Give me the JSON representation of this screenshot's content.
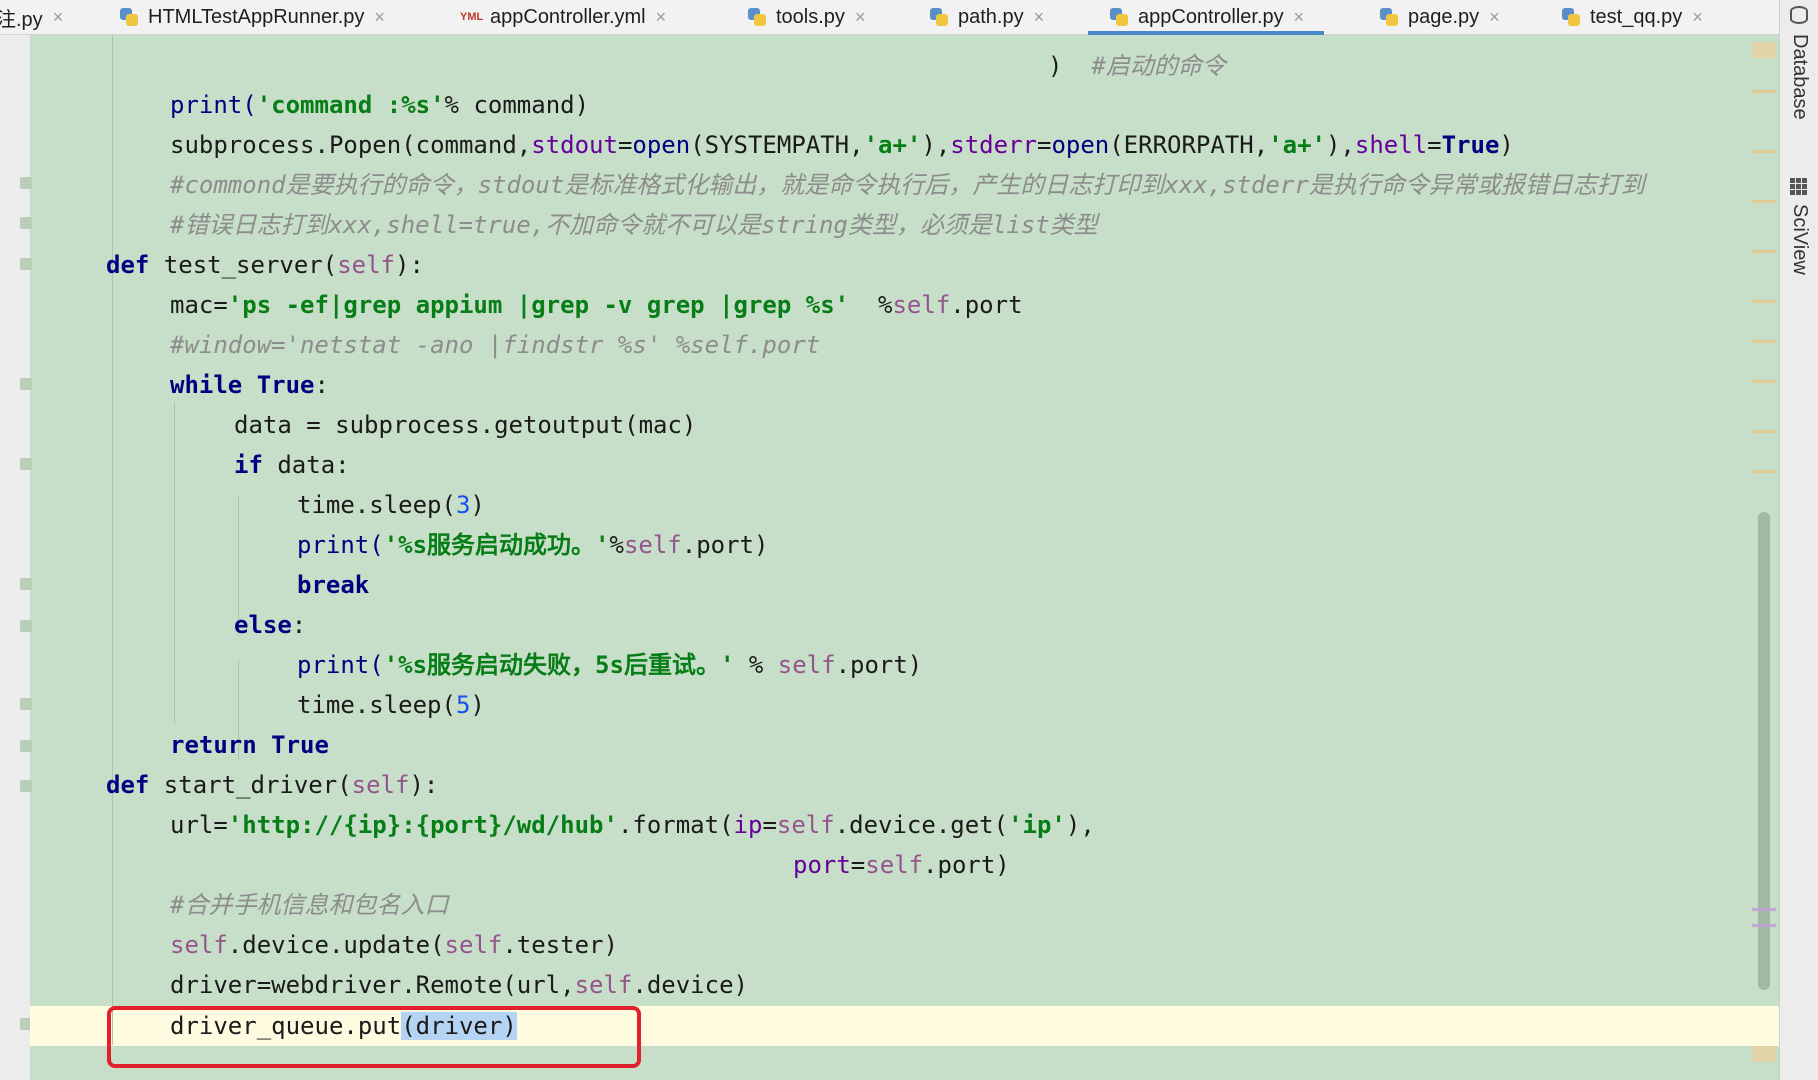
{
  "tabs": [
    {
      "label": "注.py",
      "icon": "python-file-icon",
      "active": false
    },
    {
      "label": "HTMLTestAppRunner.py",
      "icon": "python-file-icon",
      "active": false
    },
    {
      "label": "appController.yml",
      "icon": "yaml-file-icon",
      "active": false
    },
    {
      "label": "tools.py",
      "icon": "python-file-icon",
      "active": false
    },
    {
      "label": "path.py",
      "icon": "python-file-icon",
      "active": false
    },
    {
      "label": "appController.py",
      "icon": "python-file-icon",
      "active": true
    },
    {
      "label": "page.py",
      "icon": "python-file-icon",
      "active": false
    },
    {
      "label": "test_qq.py",
      "icon": "python-file-icon",
      "active": false
    }
  ],
  "tab_close_glyph": "×",
  "yml_icon_text": "YML",
  "right_panel": {
    "database_label": "Database",
    "sciview_label": "SciView"
  },
  "code": {
    "l0_close": ")",
    "l0_comment": "#启动的命令",
    "l1_print": "print(",
    "l1_str": "'command :%s'",
    "l1_rest": "% command)",
    "l2_a": "subprocess.Popen(command,",
    "l2_stdout": "stdout",
    "l2_eq1": "=",
    "l2_open1": "open",
    "l2_b": "(SYSTEMPATH,",
    "l2_str1": "'a+'",
    "l2_c": "),",
    "l2_stderr": "stderr",
    "l2_eq2": "=",
    "l2_open2": "open",
    "l2_d": "(ERRORPATH,",
    "l2_str2": "'a+'",
    "l2_e": "),",
    "l2_shell": "shell",
    "l2_eq3": "=",
    "l2_true": "True",
    "l2_f": ")",
    "l3_comment": "#commond是要执行的命令，stdout是标准格式化输出，就是命令执行后，产生的日志打印到xxx,stderr是执行命令异常或报错日志打到",
    "l4_comment": "#错误日志打到xxx,shell=true,不加命令就不可以是string类型，必须是list类型",
    "l5_def": "def",
    "l5_name": " test_server(",
    "l5_self": "self",
    "l5_end": "):",
    "l6_a": "mac=",
    "l6_str": "'ps -ef|grep appium |grep -v grep |grep %s'",
    "l6_b": "  %",
    "l6_self": "self",
    "l6_c": ".port",
    "l7_comment": "#window='netstat -ano |findstr %s' %self.port",
    "l8_while": "while",
    "l8_true": " True",
    "l8_end": ":",
    "l9": "data = subprocess.getoutput(mac)",
    "l10_if": "if",
    "l10_rest": " data:",
    "l11_a": "time.sleep(",
    "l11_num": "3",
    "l11_b": ")",
    "l12_print": "print(",
    "l12_str": "'%s服务启动成功。'",
    "l12_b": "%",
    "l12_self": "self",
    "l12_c": ".port)",
    "l13_break": "break",
    "l14_else": "else",
    "l14_end": ":",
    "l15_print": "print(",
    "l15_str": "'%s服务启动失败，5s后重试。'",
    "l15_b": " % ",
    "l15_self": "self",
    "l15_c": ".port)",
    "l16_a": "time.sleep(",
    "l16_num": "5",
    "l16_b": ")",
    "l17_return": "return",
    "l17_true": " True",
    "l18_def": "def",
    "l18_name": " start_driver(",
    "l18_self": "self",
    "l18_end": "):",
    "l19_a": "url=",
    "l19_str": "'http://{ip}:{port}/wd/hub'",
    "l19_b": ".format(",
    "l19_ip": "ip",
    "l19_c": "=",
    "l19_self": "self",
    "l19_d": ".device.get(",
    "l19_str2": "'ip'",
    "l19_e": "),",
    "l20_port": "port",
    "l20_a": "=",
    "l20_self": "self",
    "l20_b": ".port)",
    "l21_comment": "#合并手机信息和包名入口",
    "l22_self1": "self",
    "l22_a": ".device.update(",
    "l22_self2": "self",
    "l22_b": ".tester)",
    "l23_a": "driver=webdriver.Remote(url,",
    "l23_self": "self",
    "l23_b": ".device)",
    "l24_a": "driver_queue.put",
    "l24_sel": "(driver)"
  },
  "colors": {
    "editor_background": "#c7dfc8",
    "keyword": "#000080",
    "string": "#067d17",
    "comment": "#8c8c8c",
    "self": "#94558d",
    "number": "#1750eb",
    "highlight_box": "#e0202a",
    "active_tab_underline": "#4a88c7"
  }
}
